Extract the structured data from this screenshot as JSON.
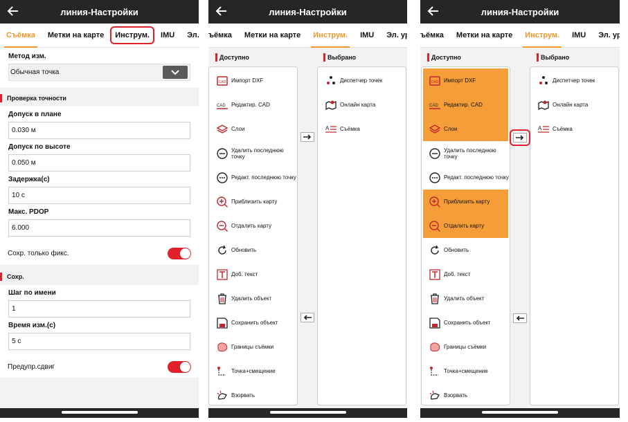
{
  "app": {
    "title": "линия-Настройки"
  },
  "tabs_s1": [
    "Съёмка",
    "Метки на карте",
    "Инструм.",
    "IMU",
    "Эл."
  ],
  "tabs_s2": [
    "ъёмка",
    "Метки на карте",
    "Инструм.",
    "IMU",
    "Эл. уровень"
  ],
  "settings": {
    "method_label": "Метод изм.",
    "method_value": "Обычная точка",
    "accuracy_header": "Проверка точности",
    "hz_tol_label": "Допуск в плане",
    "hz_tol_value": "0.030 м",
    "v_tol_label": "Допуск по высоте",
    "v_tol_value": "0.050 м",
    "delay_label": "Задержка(с)",
    "delay_value": "10 с",
    "pdop_label": "Макс. PDOP",
    "pdop_value": "6.000",
    "fixed_only_label": "Сохр. только фикс.",
    "save_header": "Сохр.",
    "name_step_label": "Шаг по имени",
    "name_step_value": "1",
    "meas_time_label": "Время изм.(с)",
    "meas_time_value": "5 с",
    "offset_warn_label": "Предупр.сдвиг"
  },
  "tools": {
    "available_header": "Доступно",
    "selected_header": "Выбрано",
    "available": [
      {
        "label": "Импорт DXF",
        "icon": "dxf-icon"
      },
      {
        "label": "Редактир. CAD",
        "icon": "cad-icon"
      },
      {
        "label": "Слои",
        "icon": "layers-icon"
      },
      {
        "label": "Удалить последнюю точку",
        "icon": "minus-circle-icon"
      },
      {
        "label": "Редакт. последнюю точку",
        "icon": "dots-circle-icon"
      },
      {
        "label": "Приблизить карту",
        "icon": "zoom-in-icon"
      },
      {
        "label": "Отдалить карту",
        "icon": "zoom-out-icon"
      },
      {
        "label": "Обновить",
        "icon": "refresh-icon"
      },
      {
        "label": "Доб. текст",
        "icon": "text-icon"
      },
      {
        "label": "Удалить объект",
        "icon": "trash-icon"
      },
      {
        "label": "Сохранить объект",
        "icon": "save-icon"
      },
      {
        "label": "Границы съёмки",
        "icon": "boundary-icon"
      },
      {
        "label": "Точка+смещение",
        "icon": "point-offset-icon"
      },
      {
        "label": "Взорвать",
        "icon": "explode-icon"
      }
    ],
    "selected": [
      {
        "label": "Диспетчер точек",
        "icon": "point-manager-icon"
      },
      {
        "label": "Онлайн карта",
        "icon": "online-map-icon"
      },
      {
        "label": "Съёмка",
        "icon": "survey-list-icon"
      }
    ]
  },
  "colors": {
    "accent": "#f0962b",
    "red": "#e0202a",
    "selected_row": "#f59d38",
    "topbar": "#262626"
  }
}
